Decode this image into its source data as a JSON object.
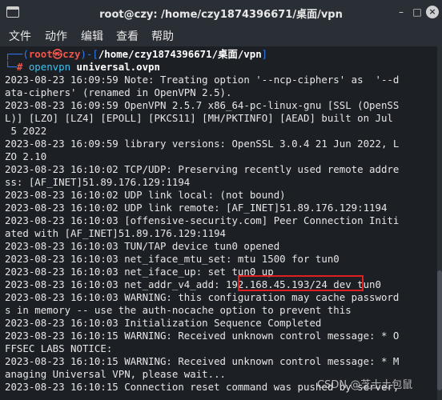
{
  "window": {
    "title": "root@czy: /home/czy1874396671/桌面/vpn",
    "min_label": "–",
    "max_label": "□",
    "close_label": "×"
  },
  "menu": {
    "file": "文件",
    "action": "动作",
    "edit": "编辑",
    "view": "查看",
    "help": "帮助"
  },
  "prompt": {
    "open": "┌──(",
    "user_host": "root㉿czy",
    "mid": ")-[",
    "path": "/home/czy1874396671/桌面/vpn",
    "close": "]",
    "second": "└─",
    "hash": "# ",
    "program": "openvpn ",
    "argument": "universal.ovpn"
  },
  "output_lines": [
    "2023-08-23 16:09:59 Note: Treating option '--ncp-ciphers' as  '--d",
    "ata-ciphers' (renamed in OpenVPN 2.5).",
    "2023-08-23 16:09:59 OpenVPN 2.5.7 x86_64-pc-linux-gnu [SSL (OpenSS",
    "L)] [LZO] [LZ4] [EPOLL] [PKCS11] [MH/PKTINFO] [AEAD] built on Jul",
    " 5 2022",
    "2023-08-23 16:09:59 library versions: OpenSSL 3.0.4 21 Jun 2022, L",
    "ZO 2.10",
    "2023-08-23 16:10:02 TCP/UDP: Preserving recently used remote addre",
    "ss: [AF_INET]51.89.176.129:1194",
    "2023-08-23 16:10:02 UDP link local: (not bound)",
    "2023-08-23 16:10:02 UDP link remote: [AF_INET]51.89.176.129:1194",
    "2023-08-23 16:10:03 [offensive-security.com] Peer Connection Initi",
    "ated with [AF_INET]51.89.176.129:1194",
    "2023-08-23 16:10:03 TUN/TAP device tun0 opened",
    "2023-08-23 16:10:03 net_iface_mtu_set: mtu 1500 for tun0",
    "2023-08-23 16:10:03 net_iface_up: set tun0 up",
    "2023-08-23 16:10:03 net_addr_v4_add: 192.168.45.193/24 dev tun0",
    "2023-08-23 16:10:03 WARNING: this configuration may cache password",
    "s in memory -- use the auth-nocache option to prevent this",
    "2023-08-23 16:10:03 Initialization Sequence Completed",
    "2023-08-23 16:10:15 WARNING: Received unknown control message: * O",
    "FFSEC LABS NOTICE:",
    "2023-08-23 16:10:15 WARNING: Received unknown control message: * M",
    "anaging Universal VPN, please wait...",
    "2023-08-23 16:10:15 Connection reset command was pushed by server,"
  ],
  "highlight_ip": "192.168.45.193/24",
  "watermark": "CSDN @芝士土包鼠",
  "colors": {
    "prompt_blue": "#2f7cf6",
    "user_red": "#f2554c",
    "command_cyan": "#3fc1f0",
    "highlight_red": "#e02020",
    "background": "#1c1f24"
  }
}
